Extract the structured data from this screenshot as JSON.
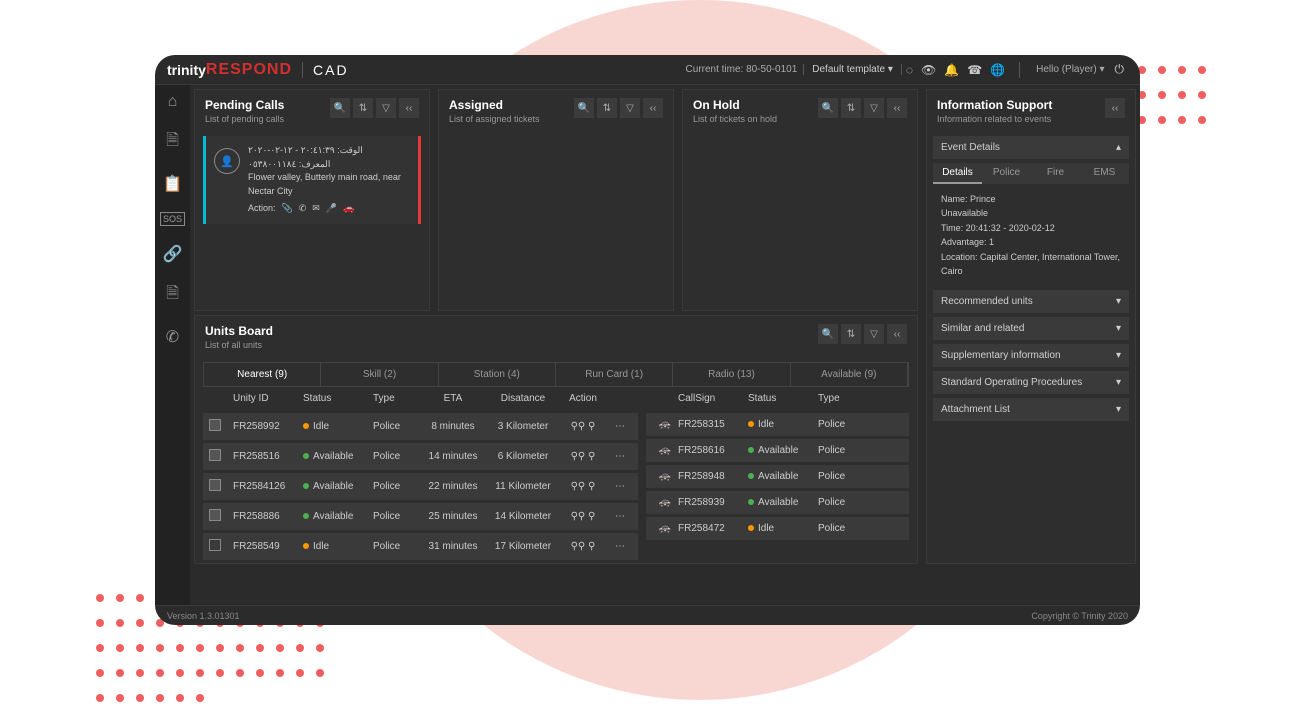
{
  "header": {
    "logo_trinity": "trinity",
    "logo_respond": "RESPOND",
    "logo_cad": "CAD",
    "current_time_label": "Current time: 80-50-0101",
    "template_label": "Default template ▾",
    "greeting": "Hello (Player) ▾"
  },
  "panels": {
    "pending": {
      "title": "Pending Calls",
      "subtitle": "List of pending calls"
    },
    "assigned": {
      "title": "Assigned",
      "subtitle": "List of assigned tickets"
    },
    "onhold": {
      "title": "On Hold",
      "subtitle": "List of tickets on hold"
    }
  },
  "call_card": {
    "line1": "الوقت: ٢٠:٤١:٣٩ - ١٢-٠٢-٢٠٢٠",
    "line2": "المعرف: ٠٥٣٨٠٠١١٨٤",
    "addr": "Flower valley, Butterly main road, near Nectar City",
    "action_label": "Action:"
  },
  "info": {
    "title": "Information Support",
    "subtitle": "Information related to events",
    "acc_event": "Event Details",
    "tabs": {
      "details": "Details",
      "police": "Police",
      "fire": "Fire",
      "ems": "EMS"
    },
    "details": {
      "name": "Name: Prince",
      "status": "Unavailable",
      "time": "Time: 20:41:32 - 2020-02-12",
      "adv": "Advantage: 1",
      "loc": "Location: Capital Center, International Tower, Cairo"
    },
    "acc_rec": "Recommended units",
    "acc_sim": "Similar and related",
    "acc_supp": "Supplementary information",
    "acc_sop": "Standard Operating Procedures",
    "acc_att": "Attachment List"
  },
  "units": {
    "title": "Units Board",
    "subtitle": "List of all units",
    "tabs": {
      "nearest": "Nearest (9)",
      "skill": "Skill (2)",
      "station": "Station (4)",
      "runcard": "Run Card (1)",
      "radio": "Radio (13)",
      "available": "Available (9)"
    },
    "headers_left": {
      "id": "Unity ID",
      "status": "Status",
      "type": "Type",
      "eta": "ETA",
      "dist": "Disatance",
      "action": "Action"
    },
    "headers_right": {
      "cs": "CallSign",
      "status": "Status",
      "type": "Type"
    },
    "left_rows": [
      {
        "chk": true,
        "id": "FR258992",
        "status": "Idle",
        "dot": "o",
        "type": "Police",
        "eta": "8 minutes",
        "dist": "3 Kilometer"
      },
      {
        "chk": true,
        "id": "FR258516",
        "status": "Available",
        "dot": "g",
        "type": "Police",
        "eta": "14 minutes",
        "dist": "6 Kilometer"
      },
      {
        "chk": true,
        "id": "FR2584126",
        "status": "Available",
        "dot": "g",
        "type": "Police",
        "eta": "22 minutes",
        "dist": "11 Kilometer"
      },
      {
        "chk": true,
        "id": "FR258886",
        "status": "Available",
        "dot": "g",
        "type": "Police",
        "eta": "25 minutes",
        "dist": "14 Kilometer"
      },
      {
        "chk": false,
        "id": "FR258549",
        "status": "Idle",
        "dot": "o",
        "type": "Police",
        "eta": "31 minutes",
        "dist": "17 Kilometer"
      }
    ],
    "right_rows": [
      {
        "cs": "FR258315",
        "status": "Idle",
        "dot": "o",
        "type": "Police"
      },
      {
        "cs": "FR258616",
        "status": "Available",
        "dot": "g",
        "type": "Police"
      },
      {
        "cs": "FR258948",
        "status": "Available",
        "dot": "g",
        "type": "Police"
      },
      {
        "cs": "FR258939",
        "status": "Available",
        "dot": "g",
        "type": "Police"
      },
      {
        "cs": "FR258472",
        "status": "Idle",
        "dot": "o",
        "type": "Police"
      }
    ]
  },
  "footer": {
    "version": "Version 1.3.01301",
    "copyright": "Copyright © Trinity 2020"
  }
}
